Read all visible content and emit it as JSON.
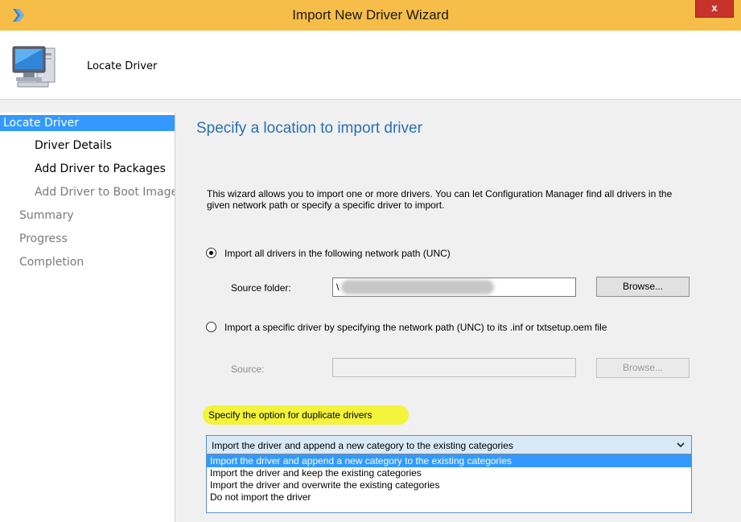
{
  "window": {
    "title": "Import New Driver Wizard",
    "close_glyph": "x",
    "icon": "wizard-arrow-icon"
  },
  "header": {
    "icon": "computer-icon",
    "step_title": "Locate Driver"
  },
  "nav": {
    "items": [
      {
        "label": "Locate Driver",
        "state": "active"
      },
      {
        "label": "Driver Details",
        "state": "sub"
      },
      {
        "label": "Add Driver to Packages",
        "state": "sub"
      },
      {
        "label": "Add Driver to Boot Images",
        "state": "disabled"
      },
      {
        "label": "Summary",
        "state": "disabled"
      },
      {
        "label": "Progress",
        "state": "disabled"
      },
      {
        "label": "Completion",
        "state": "disabled"
      }
    ]
  },
  "content": {
    "title": "Specify a location to import driver",
    "description": "This wizard allows you to import one or more drivers. You can let Configuration Manager find all drivers in the given network path or specify a specific driver to import.",
    "option_all": {
      "label": "Import all drivers in the following network path (UNC)",
      "checked": true,
      "source_label": "Source folder:",
      "source_value": "\\",
      "browse_label": "Browse..."
    },
    "option_specific": {
      "label": "Import a specific driver by specifying the network path (UNC) to its .inf or txtsetup.oem file",
      "checked": false,
      "source_label": "Source:",
      "browse_label": "Browse..."
    },
    "duplicate": {
      "label": "Specify the option for duplicate drivers",
      "selected": "Import the driver and append a new category to the existing categories",
      "options": [
        "Import the driver and append a new category to the existing categories",
        "Import the driver and keep the existing categories",
        "Import the driver and overwrite the existing categories",
        "Do not import the driver"
      ]
    }
  },
  "colors": {
    "titlebar": "#f6bd48",
    "accent": "#3399ff",
    "title_text": "#2a6fb3",
    "highlight": "#f4f43a",
    "close": "#c7332b"
  }
}
